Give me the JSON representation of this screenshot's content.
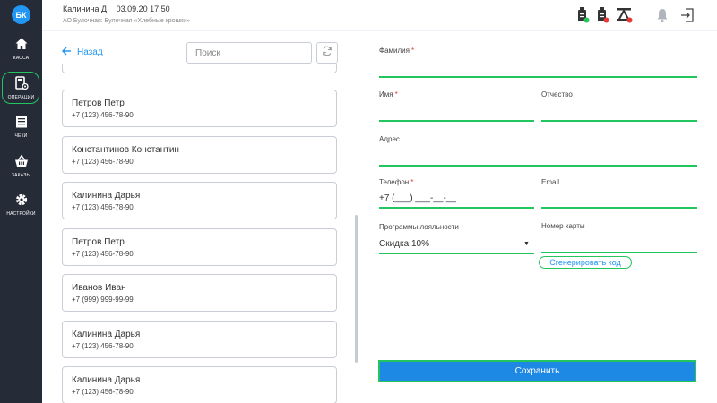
{
  "sidebar": {
    "logo": "БК",
    "items": [
      {
        "label": "КАССА",
        "icon": "home-icon"
      },
      {
        "label": "ОПЕРАЦИИ",
        "icon": "operations-icon"
      },
      {
        "label": "ЧЕКИ",
        "icon": "receipt-icon"
      },
      {
        "label": "ЗАКАЗЫ",
        "icon": "basket-icon"
      },
      {
        "label": "НАСТРОЙКИ",
        "icon": "gear-icon"
      }
    ],
    "active_item": "ОПЕРАЦИИ"
  },
  "header": {
    "user": "Калинина Д.",
    "datetime": "03.09.20 17:50",
    "org": "АО Булочная: Булочная «Хлебные крошки»",
    "status_icons": [
      "printer-ok-icon",
      "printer-error-icon",
      "connection-error-icon",
      "bell-icon",
      "logout-icon"
    ],
    "status_colors": {
      "ok": "#22c55e",
      "error": "#e53935"
    }
  },
  "left": {
    "back_label": "Назад",
    "search_placeholder": "Поиск",
    "contacts": [
      {
        "name": "Петров Петр",
        "phone": "+7 (123) 456-78-90"
      },
      {
        "name": "Константинов Константин",
        "phone": "+7 (123) 456-78-90"
      },
      {
        "name": "Калинина Дарья",
        "phone": "+7 (123) 456-78-90"
      },
      {
        "name": "Петров Петр",
        "phone": "+7 (123) 456-78-90"
      },
      {
        "name": "Иванов Иван",
        "phone": "+7 (999) 999-99-99"
      },
      {
        "name": "Калинина Дарья",
        "phone": "+7 (123) 456-78-90"
      },
      {
        "name": "Калинина Дарья",
        "phone": "+7 (123) 456-78-90"
      }
    ]
  },
  "form": {
    "surname_label": "Фамилия",
    "surname_value": "",
    "name_label": "Имя",
    "name_value": "",
    "patronymic_label": "Отчество",
    "patronymic_value": "",
    "address_label": "Адрес",
    "address_value": "",
    "phone_label": "Телефон",
    "phone_value": "+7 (___) ___-__-__",
    "email_label": "Email",
    "email_value": "",
    "loyalty_label": "Программы лояльности",
    "loyalty_value": "Скидка 10%",
    "card_label": "Номер карты",
    "card_value": "",
    "generate_label": "Сгенерировать код",
    "save_label": "Сохранить",
    "required_mark": "*"
  },
  "colors": {
    "accent": "#1e88e5",
    "highlight": "#22c55e",
    "sidebar": "#262b38"
  }
}
